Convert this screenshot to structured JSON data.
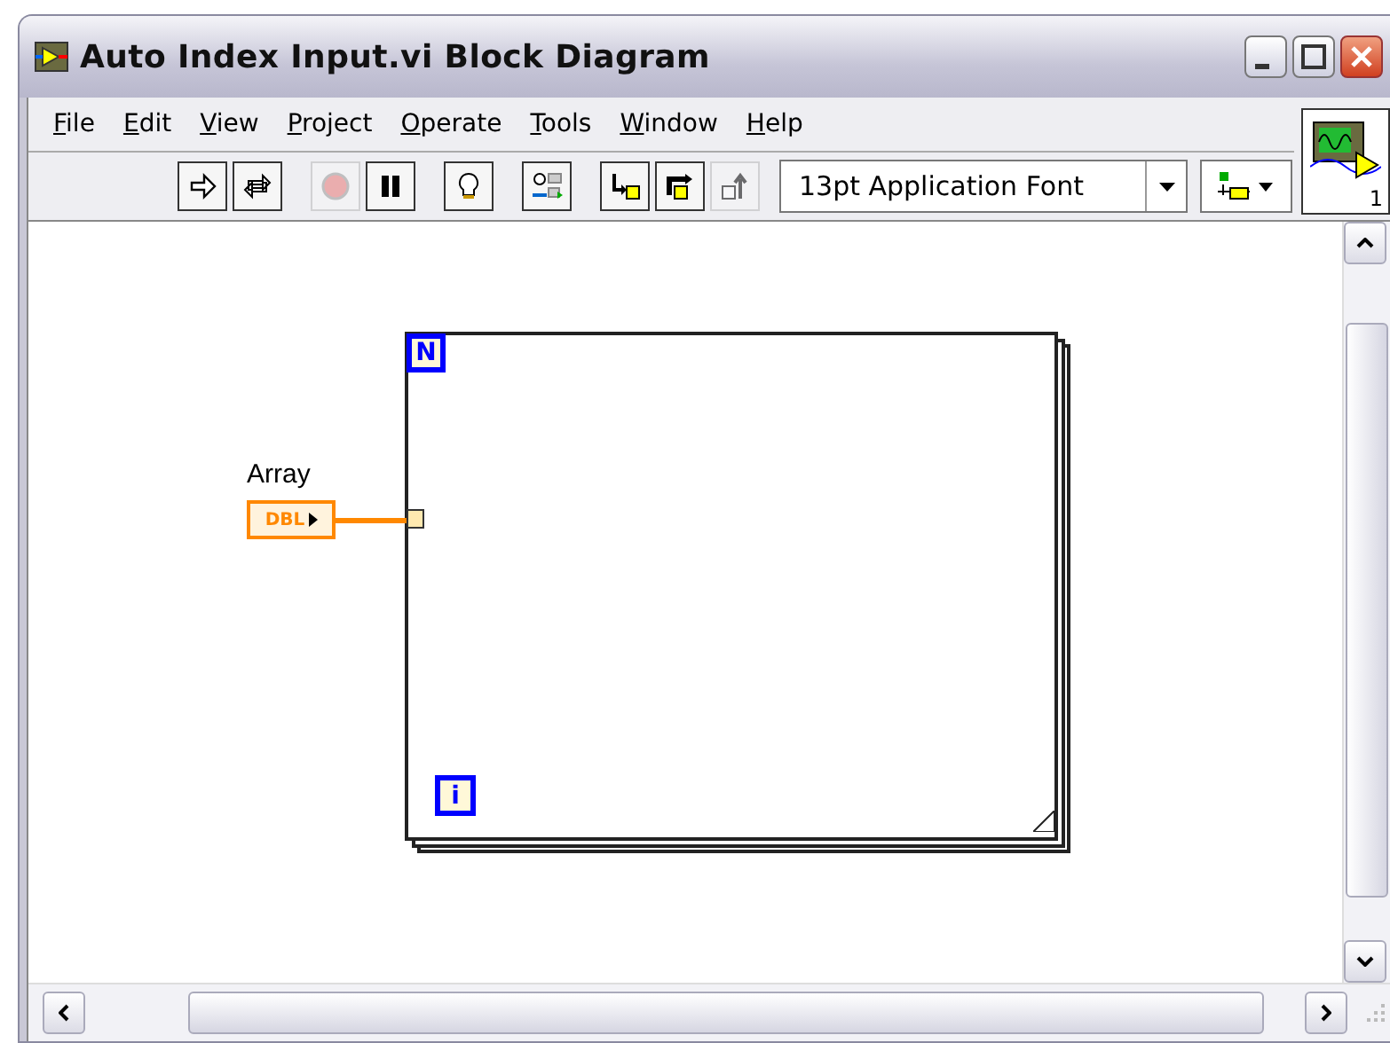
{
  "window": {
    "title": "Auto Index Input.vi Block Diagram"
  },
  "menu": [
    {
      "label": "File"
    },
    {
      "label": "Edit"
    },
    {
      "label": "View"
    },
    {
      "label": "Project"
    },
    {
      "label": "Operate"
    },
    {
      "label": "Tools"
    },
    {
      "label": "Window"
    },
    {
      "label": "Help"
    }
  ],
  "toolbar": {
    "tools": [
      {
        "kind": "run",
        "disabled": false
      },
      {
        "kind": "run-continuously",
        "disabled": false
      },
      {
        "kind": "abort",
        "disabled": true
      },
      {
        "kind": "pause",
        "disabled": false
      },
      {
        "kind": "highlight",
        "disabled": false
      },
      {
        "kind": "retain",
        "disabled": false
      },
      {
        "kind": "step-into",
        "disabled": false
      },
      {
        "kind": "step-over",
        "disabled": false
      },
      {
        "kind": "step-out",
        "disabled": true
      }
    ],
    "font_menu": {
      "value": "13pt Application Font"
    }
  },
  "icon_pane": {
    "connector": "1"
  },
  "diagram": {
    "control": {
      "label": "Array",
      "type": "DBL"
    },
    "loop": {
      "count_terminal": "N",
      "iteration_terminal": "i"
    }
  }
}
